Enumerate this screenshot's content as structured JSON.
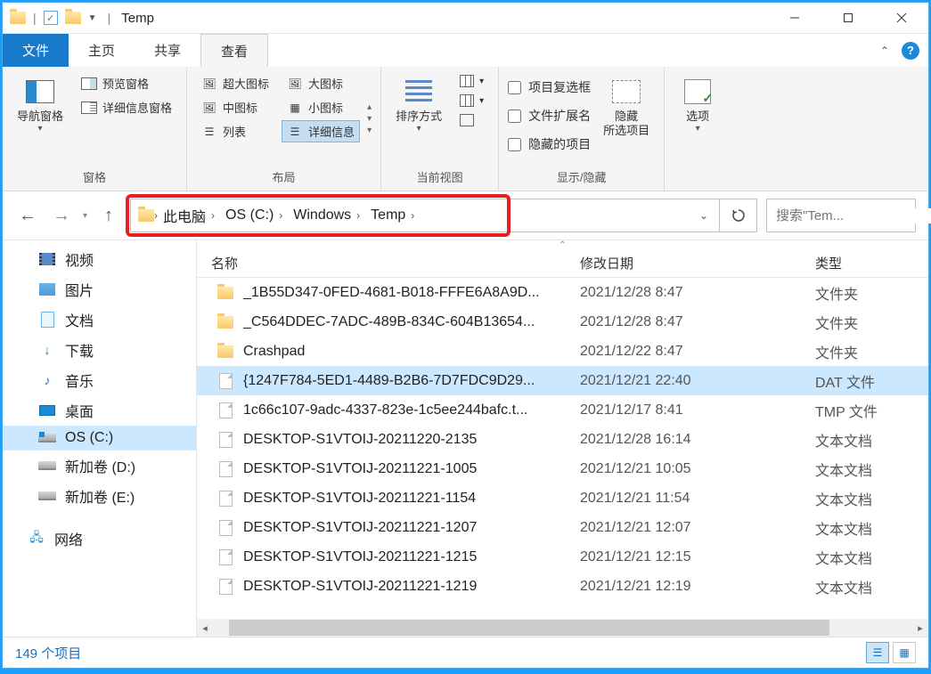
{
  "window": {
    "title": "Temp"
  },
  "tabs": {
    "file": "文件",
    "home": "主页",
    "share": "共享",
    "view": "查看"
  },
  "ribbon": {
    "panes": {
      "nav_pane": "导航窗格",
      "preview_pane": "预览窗格",
      "details_pane": "详细信息窗格",
      "group_label": "窗格"
    },
    "layout": {
      "xl_icons": "超大图标",
      "l_icons": "大图标",
      "m_icons": "中图标",
      "s_icons": "小图标",
      "list": "列表",
      "details": "详细信息",
      "group_label": "布局"
    },
    "current_view": {
      "sort_by": "排序方式",
      "add_columns": "",
      "fit_columns": "",
      "group_label": "当前视图"
    },
    "show_hide": {
      "item_checkboxes": "项目复选框",
      "file_ext": "文件扩展名",
      "hidden_items": "隐藏的项目",
      "hide_selected": "隐藏",
      "hide_selected_sub": "所选项目",
      "group_label": "显示/隐藏"
    },
    "options": {
      "label": "选项"
    }
  },
  "breadcrumb": {
    "items": [
      "此电脑",
      "OS (C:)",
      "Windows",
      "Temp"
    ]
  },
  "search": {
    "placeholder": "搜索\"Tem..."
  },
  "sidebar": {
    "items": [
      {
        "icon": "video-icon",
        "label": "视频"
      },
      {
        "icon": "pictures-icon",
        "label": "图片"
      },
      {
        "icon": "documents-icon",
        "label": "文档"
      },
      {
        "icon": "downloads-icon",
        "label": "下载"
      },
      {
        "icon": "music-icon",
        "label": "音乐"
      },
      {
        "icon": "desktop-icon",
        "label": "桌面"
      },
      {
        "icon": "osdrive-icon",
        "label": "OS (C:)",
        "selected": true
      },
      {
        "icon": "drive-icon",
        "label": "新加卷 (D:)"
      },
      {
        "icon": "drive-icon",
        "label": "新加卷 (E:)"
      }
    ],
    "network": "网络"
  },
  "columns": {
    "name": "名称",
    "date": "修改日期",
    "type": "类型"
  },
  "files": [
    {
      "icon": "folder",
      "name": "_1B55D347-0FED-4681-B018-FFFE6A8A9D...",
      "date": "2021/12/28 8:47",
      "type": "文件夹"
    },
    {
      "icon": "folder",
      "name": "_C564DDEC-7ADC-489B-834C-604B13654...",
      "date": "2021/12/28 8:47",
      "type": "文件夹"
    },
    {
      "icon": "folder",
      "name": "Crashpad",
      "date": "2021/12/22 8:47",
      "type": "文件夹"
    },
    {
      "icon": "file",
      "name": "{1247F784-5ED1-4489-B2B6-7D7FDC9D29...",
      "date": "2021/12/21 22:40",
      "type": "DAT 文件",
      "selected": true
    },
    {
      "icon": "file",
      "name": "1c66c107-9adc-4337-823e-1c5ee244bafc.t...",
      "date": "2021/12/17 8:41",
      "type": "TMP 文件"
    },
    {
      "icon": "file",
      "name": "DESKTOP-S1VTOIJ-20211220-2135",
      "date": "2021/12/28 16:14",
      "type": "文本文档"
    },
    {
      "icon": "file",
      "name": "DESKTOP-S1VTOIJ-20211221-1005",
      "date": "2021/12/21 10:05",
      "type": "文本文档"
    },
    {
      "icon": "file",
      "name": "DESKTOP-S1VTOIJ-20211221-1154",
      "date": "2021/12/21 11:54",
      "type": "文本文档"
    },
    {
      "icon": "file",
      "name": "DESKTOP-S1VTOIJ-20211221-1207",
      "date": "2021/12/21 12:07",
      "type": "文本文档"
    },
    {
      "icon": "file",
      "name": "DESKTOP-S1VTOIJ-20211221-1215",
      "date": "2021/12/21 12:15",
      "type": "文本文档"
    },
    {
      "icon": "file",
      "name": "DESKTOP-S1VTOIJ-20211221-1219",
      "date": "2021/12/21 12:19",
      "type": "文本文档"
    }
  ],
  "status": {
    "text": "149 个项目"
  }
}
